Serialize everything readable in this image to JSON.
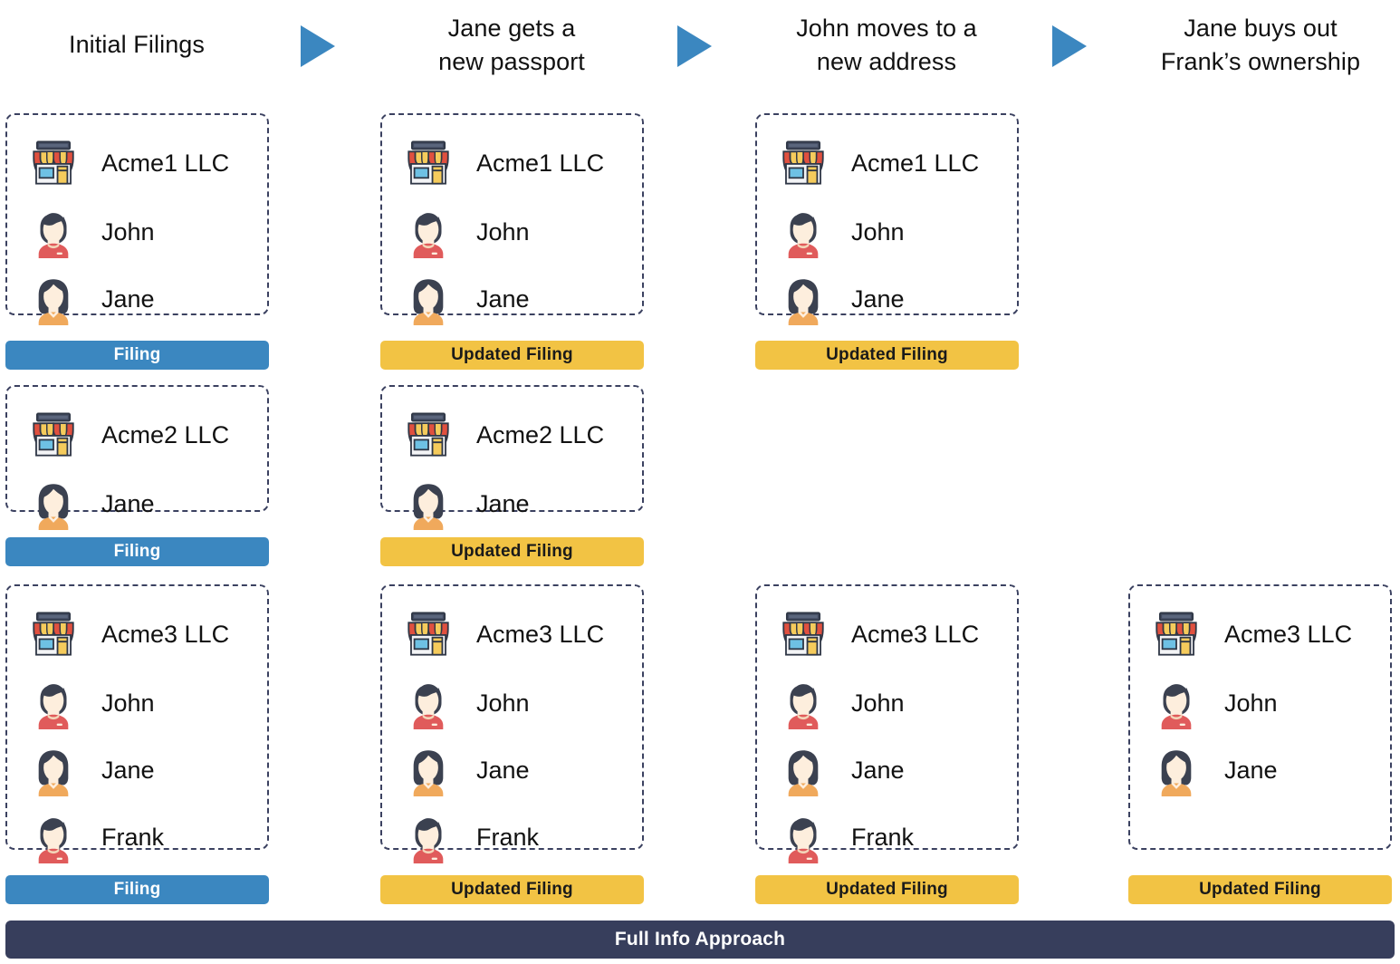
{
  "columns": [
    {
      "id": "col-initial-filings",
      "title_lines": [
        "Initial Filings"
      ]
    },
    {
      "id": "col-jane-passport",
      "title_lines": [
        "Jane gets a",
        "new passport"
      ]
    },
    {
      "id": "col-john-address",
      "title_lines": [
        "John moves to a",
        "new address"
      ]
    },
    {
      "id": "col-jane-buyout",
      "title_lines": [
        "Jane buys out",
        "Frank’s ownership"
      ]
    }
  ],
  "arrows": [
    {
      "name": "arrow-1",
      "icon": "play-triangle-right-icon"
    },
    {
      "name": "arrow-2",
      "icon": "play-triangle-right-icon"
    },
    {
      "name": "arrow-3",
      "icon": "play-triangle-right-icon"
    }
  ],
  "labels": {
    "filing": "Filing",
    "updated_filing": "Updated Filing",
    "company_icon": "storefront-icon",
    "male_icon": "male-avatar-icon",
    "female_icon": "female-avatar-icon"
  },
  "cards": [
    {
      "id": "card-acme1-col1",
      "column": 0,
      "row": 0,
      "company": "Acme1 LLC",
      "people": [
        {
          "name": "John",
          "gender": "male"
        },
        {
          "name": "Jane",
          "gender": "female"
        }
      ],
      "footer": "Filing",
      "footer_style": "filing"
    },
    {
      "id": "card-acme1-col2",
      "column": 1,
      "row": 0,
      "company": "Acme1 LLC",
      "people": [
        {
          "name": "John",
          "gender": "male"
        },
        {
          "name": "Jane",
          "gender": "female"
        }
      ],
      "footer": "Updated Filing",
      "footer_style": "updated"
    },
    {
      "id": "card-acme1-col3",
      "column": 2,
      "row": 0,
      "company": "Acme1 LLC",
      "people": [
        {
          "name": "John",
          "gender": "male"
        },
        {
          "name": "Jane",
          "gender": "female"
        }
      ],
      "footer": "Updated Filing",
      "footer_style": "updated"
    },
    {
      "id": "card-acme2-col1",
      "column": 0,
      "row": 1,
      "company": "Acme2 LLC",
      "people": [
        {
          "name": "Jane",
          "gender": "female"
        }
      ],
      "footer": "Filing",
      "footer_style": "filing"
    },
    {
      "id": "card-acme2-col2",
      "column": 1,
      "row": 1,
      "company": "Acme2 LLC",
      "people": [
        {
          "name": "Jane",
          "gender": "female"
        }
      ],
      "footer": "Updated Filing",
      "footer_style": "updated"
    },
    {
      "id": "card-acme3-col1",
      "column": 0,
      "row": 2,
      "company": "Acme3 LLC",
      "people": [
        {
          "name": "John",
          "gender": "male"
        },
        {
          "name": "Jane",
          "gender": "female"
        },
        {
          "name": "Frank",
          "gender": "male"
        }
      ],
      "footer": "Filing",
      "footer_style": "filing"
    },
    {
      "id": "card-acme3-col2",
      "column": 1,
      "row": 2,
      "company": "Acme3 LLC",
      "people": [
        {
          "name": "John",
          "gender": "male"
        },
        {
          "name": "Jane",
          "gender": "female"
        },
        {
          "name": "Frank",
          "gender": "male"
        }
      ],
      "footer": "Updated Filing",
      "footer_style": "updated"
    },
    {
      "id": "card-acme3-col3",
      "column": 2,
      "row": 2,
      "company": "Acme3 LLC",
      "people": [
        {
          "name": "John",
          "gender": "male"
        },
        {
          "name": "Jane",
          "gender": "female"
        },
        {
          "name": "Frank",
          "gender": "male"
        }
      ],
      "footer": "Updated Filing",
      "footer_style": "updated"
    },
    {
      "id": "card-acme3-col4",
      "column": 3,
      "row": 2,
      "company": "Acme3 LLC",
      "people": [
        {
          "name": "John",
          "gender": "male"
        },
        {
          "name": "Jane",
          "gender": "female"
        }
      ],
      "footer": "Updated Filing",
      "footer_style": "updated"
    }
  ],
  "banner": {
    "text": "Full Info Approach"
  },
  "colors": {
    "filing_blue": "#3b87c0",
    "updated_yellow": "#f2c344",
    "banner_navy": "#373e5c",
    "card_border": "#3b4160",
    "arrow_blue": "#3b87c0",
    "text_dark": "#111111"
  }
}
